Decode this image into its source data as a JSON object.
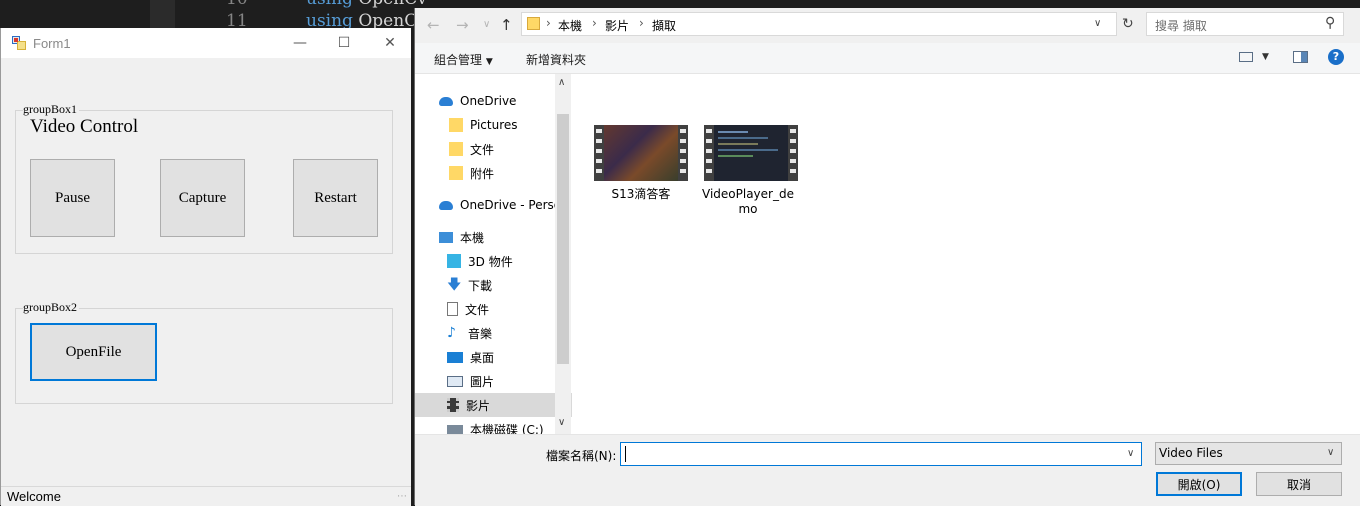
{
  "editor": {
    "line_numbers": [
      "10",
      "11"
    ],
    "lines": [
      {
        "keyword": "using",
        "ident": "OpenCv"
      },
      {
        "keyword": "using",
        "ident": "OpenCv"
      }
    ]
  },
  "form1": {
    "title": "Form1",
    "group1": {
      "label": "groupBox1",
      "heading": "Video Control",
      "buttons": {
        "pause": "Pause",
        "capture": "Capture",
        "restart": "Restart"
      }
    },
    "group2": {
      "label": "groupBox2",
      "buttons": {
        "openfile": "OpenFile"
      }
    },
    "status": "Welcome"
  },
  "dialog": {
    "breadcrumb": [
      "本機",
      "影片",
      "擷取"
    ],
    "search_placeholder": "搜尋 擷取",
    "toolbar": {
      "organize": "組合管理",
      "new_folder": "新增資料夾"
    },
    "nav": {
      "onedrive": "OneDrive",
      "pictures": "Pictures",
      "wenjian": "文件",
      "fujian": "附件",
      "onedrive_personal": "OneDrive - Perso",
      "this_pc": "本機",
      "objects3d": "3D 物件",
      "downloads": "下載",
      "documents": "文件",
      "music": "音樂",
      "desktop": "桌面",
      "pictures_zh": "圖片",
      "videos": "影片",
      "drive_c": "本機磁碟 (C:)"
    },
    "files": [
      {
        "name": "S13滴答客"
      },
      {
        "name": "VideoPlayer_demo"
      }
    ],
    "filename_label": "檔案名稱(N):",
    "filename_value": "",
    "filetype": "Video Files",
    "open_label": "開啟(O)",
    "cancel_label": "取消"
  }
}
